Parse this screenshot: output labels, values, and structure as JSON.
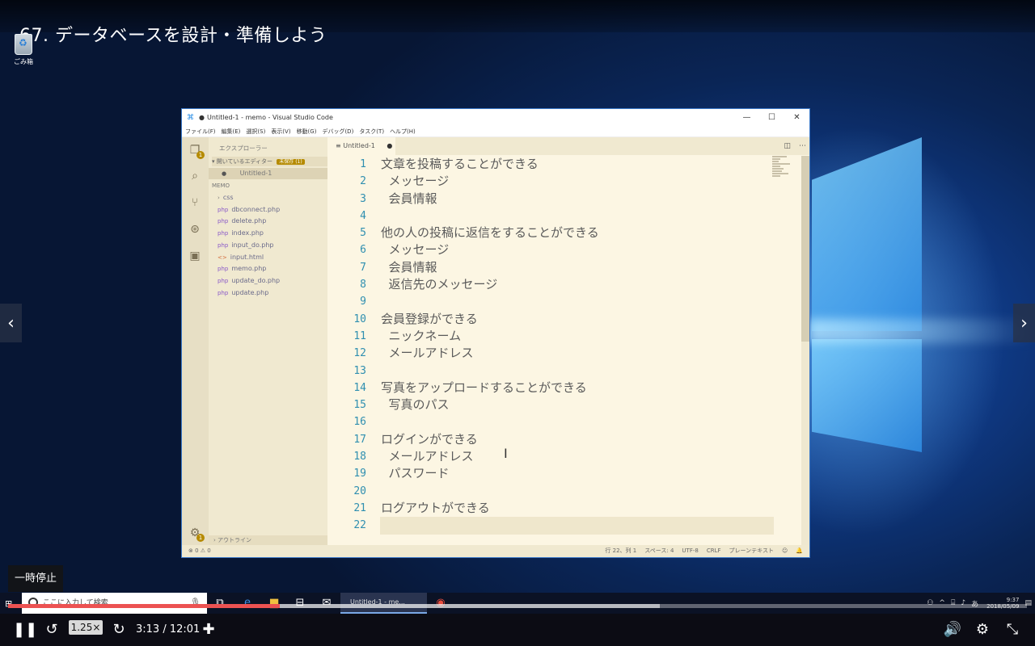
{
  "video": {
    "title": "67. データベースを設計・準備しよう",
    "tooltip": "一時停止",
    "speed": "1.25×",
    "time": "3:13 / 12:01",
    "progress_fraction": 0.267,
    "buffered_fraction": 0.64
  },
  "desktop": {
    "trash_label": "ごみ箱"
  },
  "vscode": {
    "window_title": "Untitled-1 - memo - Visual Studio Code",
    "menu": [
      "ファイル(F)",
      "編集(E)",
      "選択(S)",
      "表示(V)",
      "移動(G)",
      "デバッグ(D)",
      "タスク(T)",
      "ヘルプ(H)"
    ],
    "explorer_title": "エクスプローラー",
    "open_editors_label": "開いているエディター",
    "unsaved_badge": "未保存 (1)",
    "open_file": "Untitled-1",
    "folder_label": "MEMO",
    "files": [
      {
        "name": "css",
        "type": "folder"
      },
      {
        "name": "dbconnect.php",
        "type": "php"
      },
      {
        "name": "delete.php",
        "type": "php"
      },
      {
        "name": "index.php",
        "type": "php"
      },
      {
        "name": "input_do.php",
        "type": "php"
      },
      {
        "name": "input.html",
        "type": "html"
      },
      {
        "name": "memo.php",
        "type": "php"
      },
      {
        "name": "update_do.php",
        "type": "php"
      },
      {
        "name": "update.php",
        "type": "php"
      }
    ],
    "outline_label": "アウトライン",
    "tab_label": "Untitled-1",
    "explorer_badge": "1",
    "settings_badge": "1",
    "lines": [
      "文章を投稿することができる",
      "  メッセージ",
      "  会員情報",
      "",
      "他の人の投稿に返信をすることができる",
      "  メッセージ",
      "  会員情報",
      "  返信先のメッセージ",
      "",
      "会員登録ができる",
      "  ニックネーム",
      "  メールアドレス",
      "",
      "写真をアップロードすることができる",
      "  写真のパス",
      "",
      "ログインができる",
      "  メールアドレス",
      "  パスワード",
      "",
      "ログアウトができる",
      ""
    ],
    "status_left": "⊗ 0  ⚠ 0",
    "status_right": [
      "行 22、列 1",
      "スペース: 4",
      "UTF-8",
      "CRLF",
      "プレーンテキスト"
    ]
  },
  "taskbar": {
    "search_placeholder": "ここに入力して検索",
    "active_app": "Untitled-1 - me...",
    "ime": "あ",
    "clock_time": "9:37",
    "clock_date": "2018/05/09"
  }
}
